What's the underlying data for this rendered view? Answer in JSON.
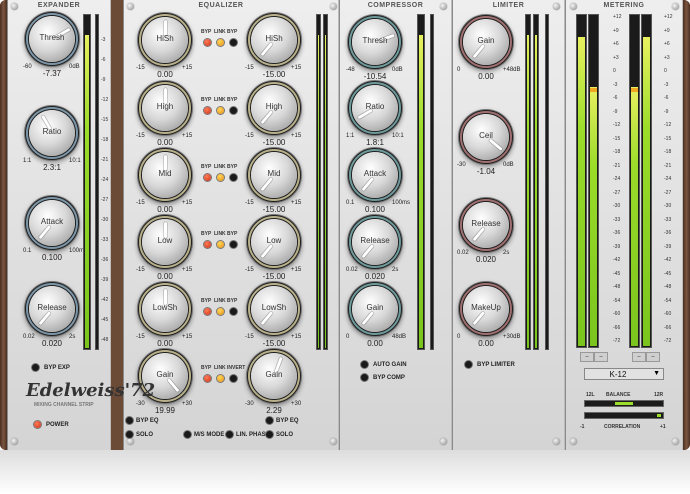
{
  "panels": {
    "expander": "EXPANDER",
    "equalizer": "EQUALIZER",
    "compressor": "COMPRESSOR",
    "limiter": "LIMITER",
    "metering": "METERING"
  },
  "expander": {
    "knobs": [
      {
        "label": "Thresh",
        "min": "-60",
        "max": "0dB",
        "value": "-7.37"
      },
      {
        "label": "Ratio",
        "min": "1:1",
        "max": "10:1",
        "value": "2.3:1"
      },
      {
        "label": "Attack",
        "min": "0.1",
        "max": "100ms",
        "value": "0.100"
      },
      {
        "label": "Release",
        "min": "0.02",
        "max": "2s",
        "value": "0.020"
      }
    ],
    "byp_exp": "BYP EXP"
  },
  "equalizer": {
    "rows": [
      {
        "left": {
          "label": "HiSh",
          "min": "-15",
          "max": "+15",
          "value": "0.00"
        },
        "right": {
          "label": "HiSh",
          "min": "-15",
          "max": "+15",
          "value": "-15.00"
        },
        "led_labels": [
          "BYP",
          "LINK",
          "BYP"
        ]
      },
      {
        "left": {
          "label": "High",
          "min": "-15",
          "max": "+15",
          "value": "0.00"
        },
        "right": {
          "label": "High",
          "min": "-15",
          "max": "+15",
          "value": "-15.00"
        },
        "led_labels": [
          "BYP",
          "LINK",
          "BYP"
        ]
      },
      {
        "left": {
          "label": "Mid",
          "min": "-15",
          "max": "+15",
          "value": "0.00"
        },
        "right": {
          "label": "Mid",
          "min": "-15",
          "max": "+15",
          "value": "-15.00"
        },
        "led_labels": [
          "BYP",
          "LINK",
          "BYP"
        ]
      },
      {
        "left": {
          "label": "Low",
          "min": "-15",
          "max": "+15",
          "value": "0.00"
        },
        "right": {
          "label": "Low",
          "min": "-15",
          "max": "+15",
          "value": "-15.00"
        },
        "led_labels": [
          "BYP",
          "LINK",
          "BYP"
        ]
      },
      {
        "left": {
          "label": "LowSh",
          "min": "-15",
          "max": "+15",
          "value": "0.00"
        },
        "right": {
          "label": "LowSh",
          "min": "-15",
          "max": "+15",
          "value": "-15.00"
        },
        "led_labels": [
          "BYP",
          "LINK",
          "BYP"
        ]
      },
      {
        "left": {
          "label": "Gain",
          "min": "-30",
          "max": "+30",
          "value": "19.99"
        },
        "right": {
          "label": "Gain",
          "min": "-30",
          "max": "+30",
          "value": "2.29"
        },
        "led_labels": [
          "BYP",
          "LINK",
          "INVERT"
        ]
      }
    ],
    "switches": [
      "BYP EQ",
      "BYP EQ",
      "SOLO",
      "M/S MODE",
      "LIN. PHASE",
      "SOLO"
    ]
  },
  "compressor": {
    "knobs": [
      {
        "label": "Thresh",
        "min": "-48",
        "max": "0dB",
        "value": "-10.54"
      },
      {
        "label": "Ratio",
        "min": "1:1",
        "max": "10:1",
        "value": "1.8:1"
      },
      {
        "label": "Attack",
        "min": "0.1",
        "max": "100ms",
        "value": "0.100"
      },
      {
        "label": "Release",
        "min": "0.02",
        "max": "2s",
        "value": "0.020"
      },
      {
        "label": "Gain",
        "min": "0",
        "max": "48dB",
        "value": "0.00"
      }
    ],
    "auto_gain": "AUTO GAIN",
    "byp_comp": "BYP COMP"
  },
  "limiter": {
    "knobs": [
      {
        "label": "Gain",
        "min": "0",
        "max": "+48dB",
        "value": "0.00"
      },
      {
        "label": "Ceil",
        "min": "-30",
        "max": "0dB",
        "value": "-1.04"
      },
      {
        "label": "Release",
        "min": "0.02",
        "max": "2s",
        "value": "0.020"
      },
      {
        "label": "MakeUp",
        "min": "0",
        "max": "+30dB",
        "value": "0.00"
      }
    ],
    "byp_limiter": "BYP LIMITER"
  },
  "metering": {
    "scale": [
      "+12",
      "+9",
      "+6",
      "+3",
      "0",
      "-3",
      "-6",
      "-9",
      "-12",
      "-15",
      "-18",
      "-21",
      "-24",
      "-27",
      "-30",
      "-33",
      "-36",
      "-39",
      "-42",
      "-45",
      "-48",
      "-54",
      "-60",
      "-66",
      "-72"
    ],
    "peak_readouts": [
      "--",
      "--",
      "--",
      "--"
    ],
    "mode": "K-12",
    "balance": "BALANCE",
    "bal_left": "12L",
    "bal_right": "12R",
    "correlation": "CORRELATION",
    "corr_left": "-1",
    "corr_right": "+1",
    "levels": [
      0.93,
      0.78,
      0.78,
      0.93
    ]
  },
  "brand": {
    "name": "Edelweiss'72",
    "sub": "MIXING CHANNEL STRIP"
  },
  "power": "POWER",
  "meter_scale": [
    "",
    "-3",
    "-6",
    "-9",
    "-12",
    "-15",
    "-18",
    "-21",
    "-24",
    "-27",
    "-30",
    "-33",
    "-36",
    "-39",
    "-42",
    "-45",
    "-48"
  ],
  "colors": {
    "knob_ring_expander": "#7c96a8",
    "knob_ring_eq": "#b8b08a",
    "knob_ring_comp": "#6f9a9c",
    "knob_ring_limiter": "#a07070",
    "meter_green": "#9cdc2a",
    "gr_red": "#d63d1f"
  }
}
